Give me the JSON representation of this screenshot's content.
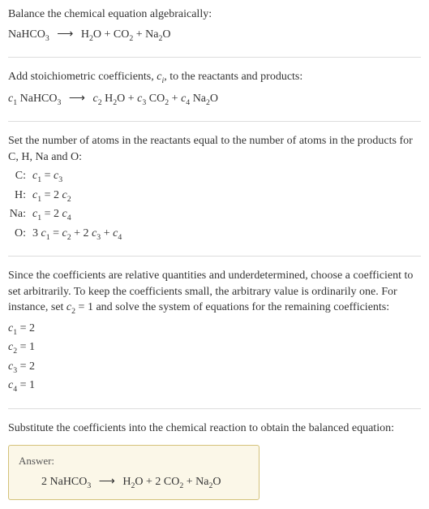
{
  "s1": {
    "title": "Balance the chemical equation algebraically:",
    "lhs": "NaHCO",
    "lhs_sub": "3",
    "rhs_parts": [
      {
        "t": "H",
        "s": "2"
      },
      {
        "t": "O + CO",
        "s": "2"
      },
      {
        "t": " + Na",
        "s": "2"
      },
      {
        "t": "O",
        "s": ""
      }
    ]
  },
  "s2": {
    "title": "Add stoichiometric coefficients, ",
    "var": "c",
    "sub": "i",
    "title2": ", to the reactants and products:",
    "eq": "c₁ NaHCO₃  ⟶  c₂ H₂O + c₃ CO₂ + c₄ Na₂O"
  },
  "s3": {
    "title": "Set the number of atoms in the reactants equal to the number of atoms in the products for C, H, Na and O:",
    "rows": [
      {
        "label": "C:",
        "eq": "c₁ = c₃"
      },
      {
        "label": "H:",
        "eq": "c₁ = 2 c₂"
      },
      {
        "label": "Na:",
        "eq": "c₁ = 2 c₄"
      },
      {
        "label": "O:",
        "eq": "3 c₁ = c₂ + 2 c₃ + c₄"
      }
    ]
  },
  "s4": {
    "title": "Since the coefficients are relative quantities and underdetermined, choose a coefficient to set arbitrarily. To keep the coefficients small, the arbitrary value is ordinarily one. For instance, set c₂ = 1 and solve the system of equations for the remaining coefficients:",
    "coeffs": [
      "c₁ = 2",
      "c₂ = 1",
      "c₃ = 2",
      "c₄ = 1"
    ]
  },
  "s5": {
    "title": "Substitute the coefficients into the chemical reaction to obtain the balanced equation:",
    "answer_label": "Answer:",
    "answer_eq": "2 NaHCO₃  ⟶  H₂O + 2 CO₂ + Na₂O"
  },
  "chart_data": {
    "type": "table",
    "title": "Atom balance equations and solved stoichiometric coefficients",
    "balance_equations": {
      "C": "c1 = c3",
      "H": "c1 = 2 c2",
      "Na": "c1 = 2 c4",
      "O": "3 c1 = c2 + 2 c3 + c4"
    },
    "solved_coefficients": {
      "c1": 2,
      "c2": 1,
      "c3": 2,
      "c4": 1
    },
    "balanced_equation": "2 NaHCO3 -> H2O + 2 CO2 + Na2O"
  }
}
